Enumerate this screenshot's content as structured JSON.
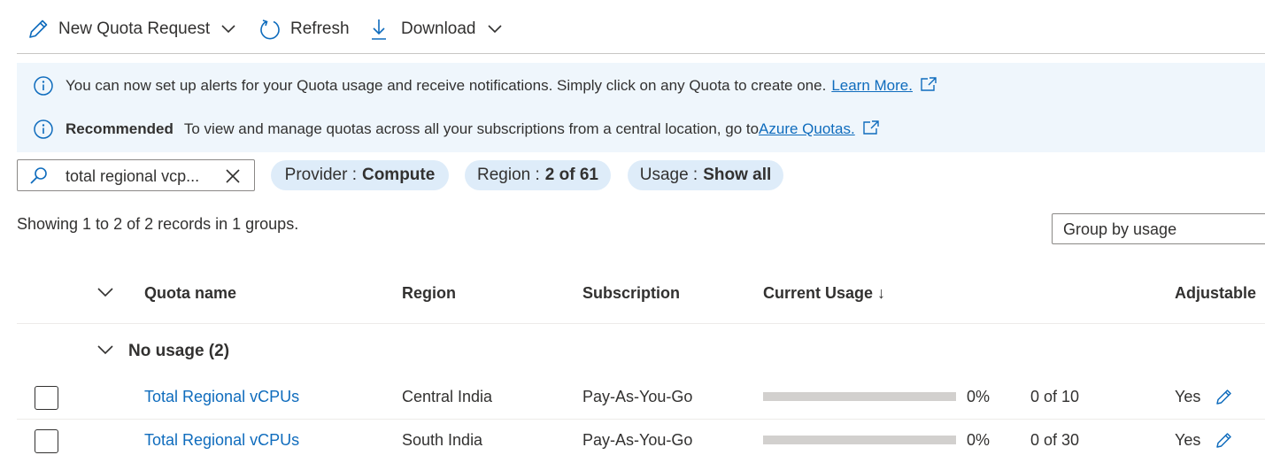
{
  "toolbar": {
    "new_quota": "New Quota Request",
    "refresh": "Refresh",
    "download": "Download"
  },
  "banner": {
    "alerts_text": "You can now set up alerts for your Quota usage and receive notifications. Simply click on any Quota to create one.",
    "alerts_link": "Learn More.",
    "recommended_label": "Recommended",
    "recommended_text": "To view and manage quotas across all your subscriptions from a central location, go to",
    "recommended_link": "Azure Quotas."
  },
  "filters": {
    "search_value": "total regional vcp...",
    "provider_label": "Provider :",
    "provider_value": "Compute",
    "region_label": "Region :",
    "region_value": "2 of 61",
    "usage_label": "Usage :",
    "usage_value": "Show all"
  },
  "records_text": "Showing 1 to 2 of 2 records in 1 groups.",
  "group_by": "Group by usage",
  "table": {
    "headers": {
      "quota_name": "Quota name",
      "region": "Region",
      "subscription": "Subscription",
      "current_usage": "Current Usage ↓",
      "adjustable": "Adjustable"
    },
    "group_title": "No usage (2)",
    "rows": [
      {
        "quota_name": "Total Regional vCPUs",
        "region": "Central India",
        "subscription": "Pay-As-You-Go",
        "usage_fraction": 0,
        "percent": "0%",
        "count": "0 of 10",
        "adjustable": "Yes"
      },
      {
        "quota_name": "Total Regional vCPUs",
        "region": "South India",
        "subscription": "Pay-As-You-Go",
        "usage_fraction": 0,
        "percent": "0%",
        "count": "0 of 30",
        "adjustable": "Yes"
      }
    ]
  },
  "colors": {
    "accent": "#0f6cbd",
    "banner_bg": "#eff6fc",
    "pill_bg": "#deecf9",
    "bar_track": "#d2d0ce"
  }
}
